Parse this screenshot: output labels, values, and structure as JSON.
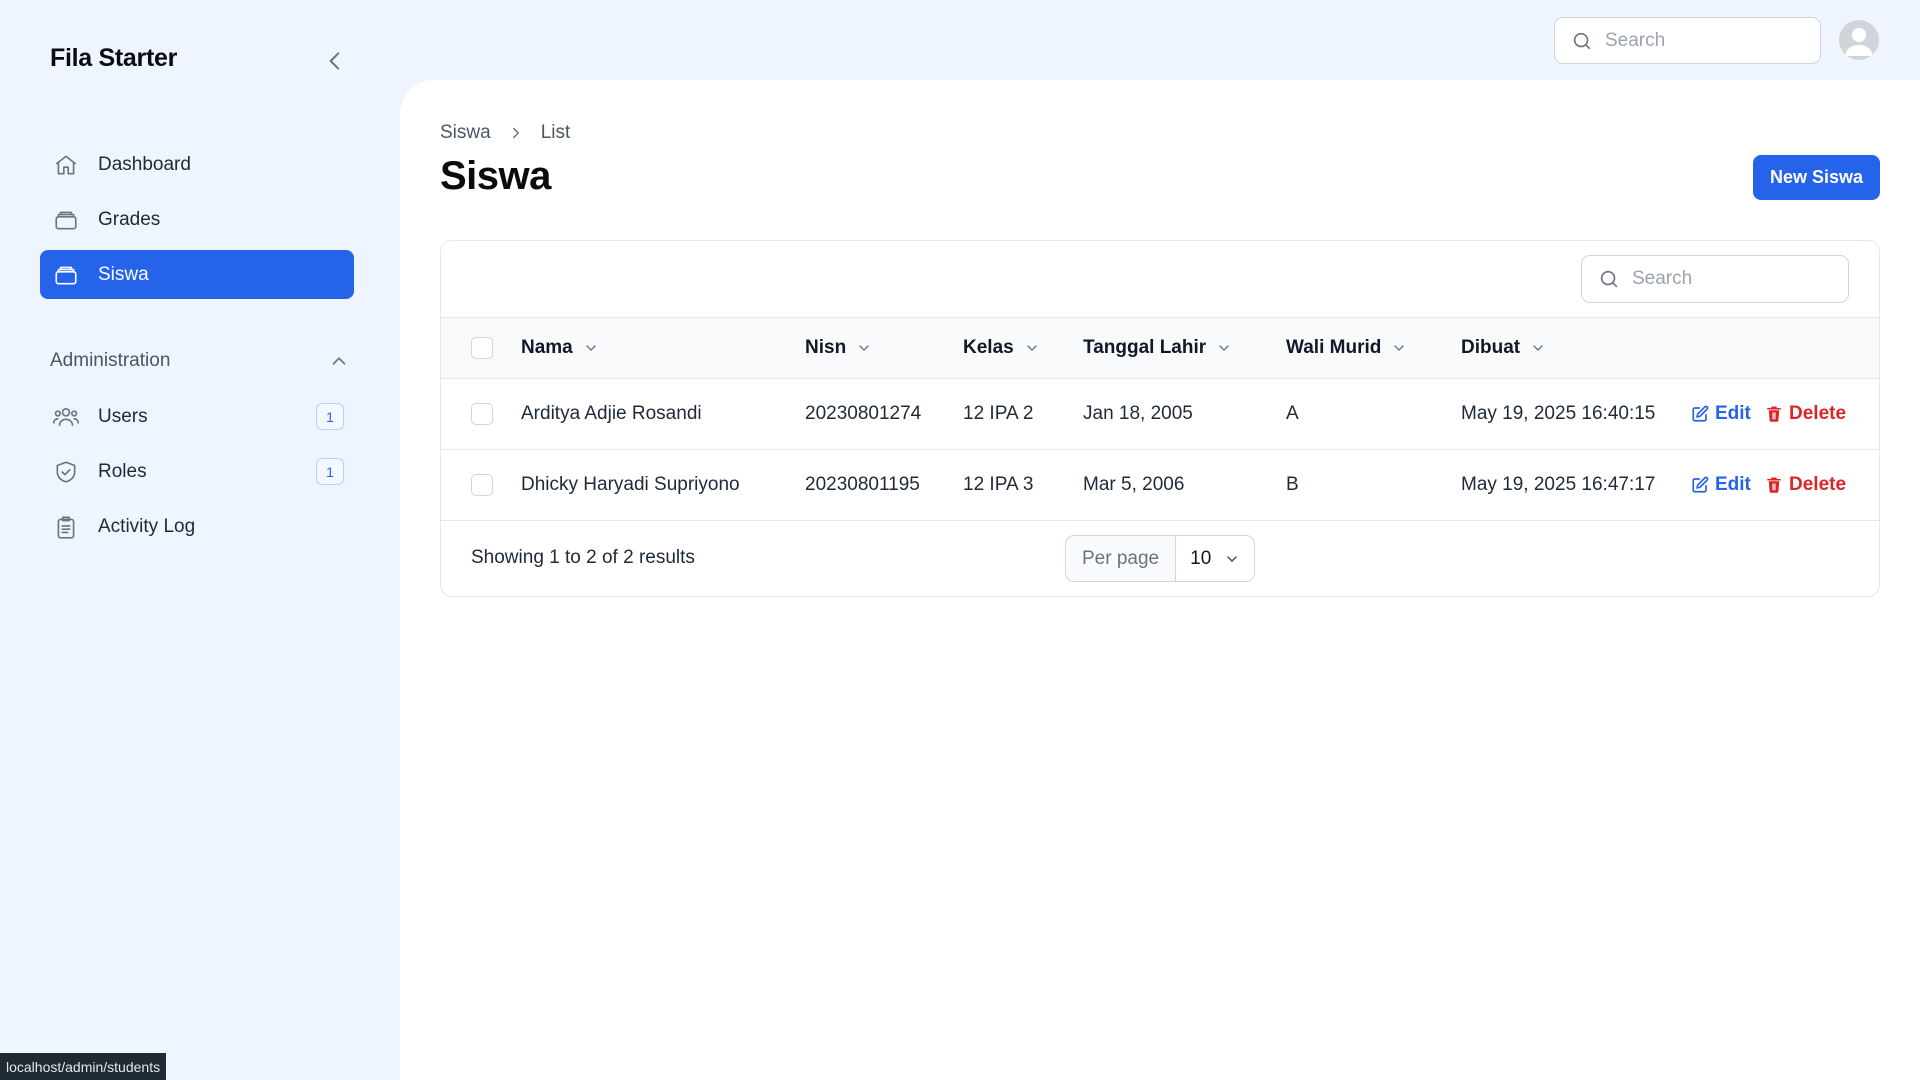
{
  "app": {
    "brand": "Fila Starter"
  },
  "topbar": {
    "search_placeholder": "Search"
  },
  "sidebar": {
    "items": [
      {
        "label": "Dashboard",
        "icon": "home-icon",
        "active": false
      },
      {
        "label": "Grades",
        "icon": "archive-icon",
        "active": false
      },
      {
        "label": "Siswa",
        "icon": "archive-icon",
        "active": true
      }
    ],
    "group": {
      "label": "Administration",
      "items": [
        {
          "label": "Users",
          "icon": "users-icon",
          "badge": "1"
        },
        {
          "label": "Roles",
          "icon": "shield-check-icon",
          "badge": "1"
        },
        {
          "label": "Activity Log",
          "icon": "clipboard-icon"
        }
      ]
    }
  },
  "breadcrumb": {
    "parent": "Siswa",
    "current": "List"
  },
  "page": {
    "title": "Siswa",
    "new_button": "New Siswa"
  },
  "table": {
    "search_placeholder": "Search",
    "columns": [
      "Nama",
      "Nisn",
      "Kelas",
      "Tanggal Lahir",
      "Wali Murid",
      "Dibuat"
    ],
    "rows": [
      [
        "Arditya Adjie Rosandi",
        "20230801274",
        "12 IPA 2",
        "Jan 18, 2005",
        "A",
        "May 19, 2025 16:40:15"
      ],
      [
        "Dhicky Haryadi Supriyono",
        "20230801195",
        "12 IPA 3",
        "Mar 5, 2006",
        "B",
        "May 19, 2025 16:47:17"
      ]
    ],
    "edit_label": "Edit",
    "delete_label": "Delete",
    "results_text": "Showing 1 to 2 of 2 results",
    "per_page_label": "Per page",
    "per_page_value": "10"
  },
  "statusbar": {
    "url": "localhost/admin/students"
  },
  "colors": {
    "primary": "#2563eb",
    "danger": "#dc2626",
    "background": "#eef5fe"
  }
}
